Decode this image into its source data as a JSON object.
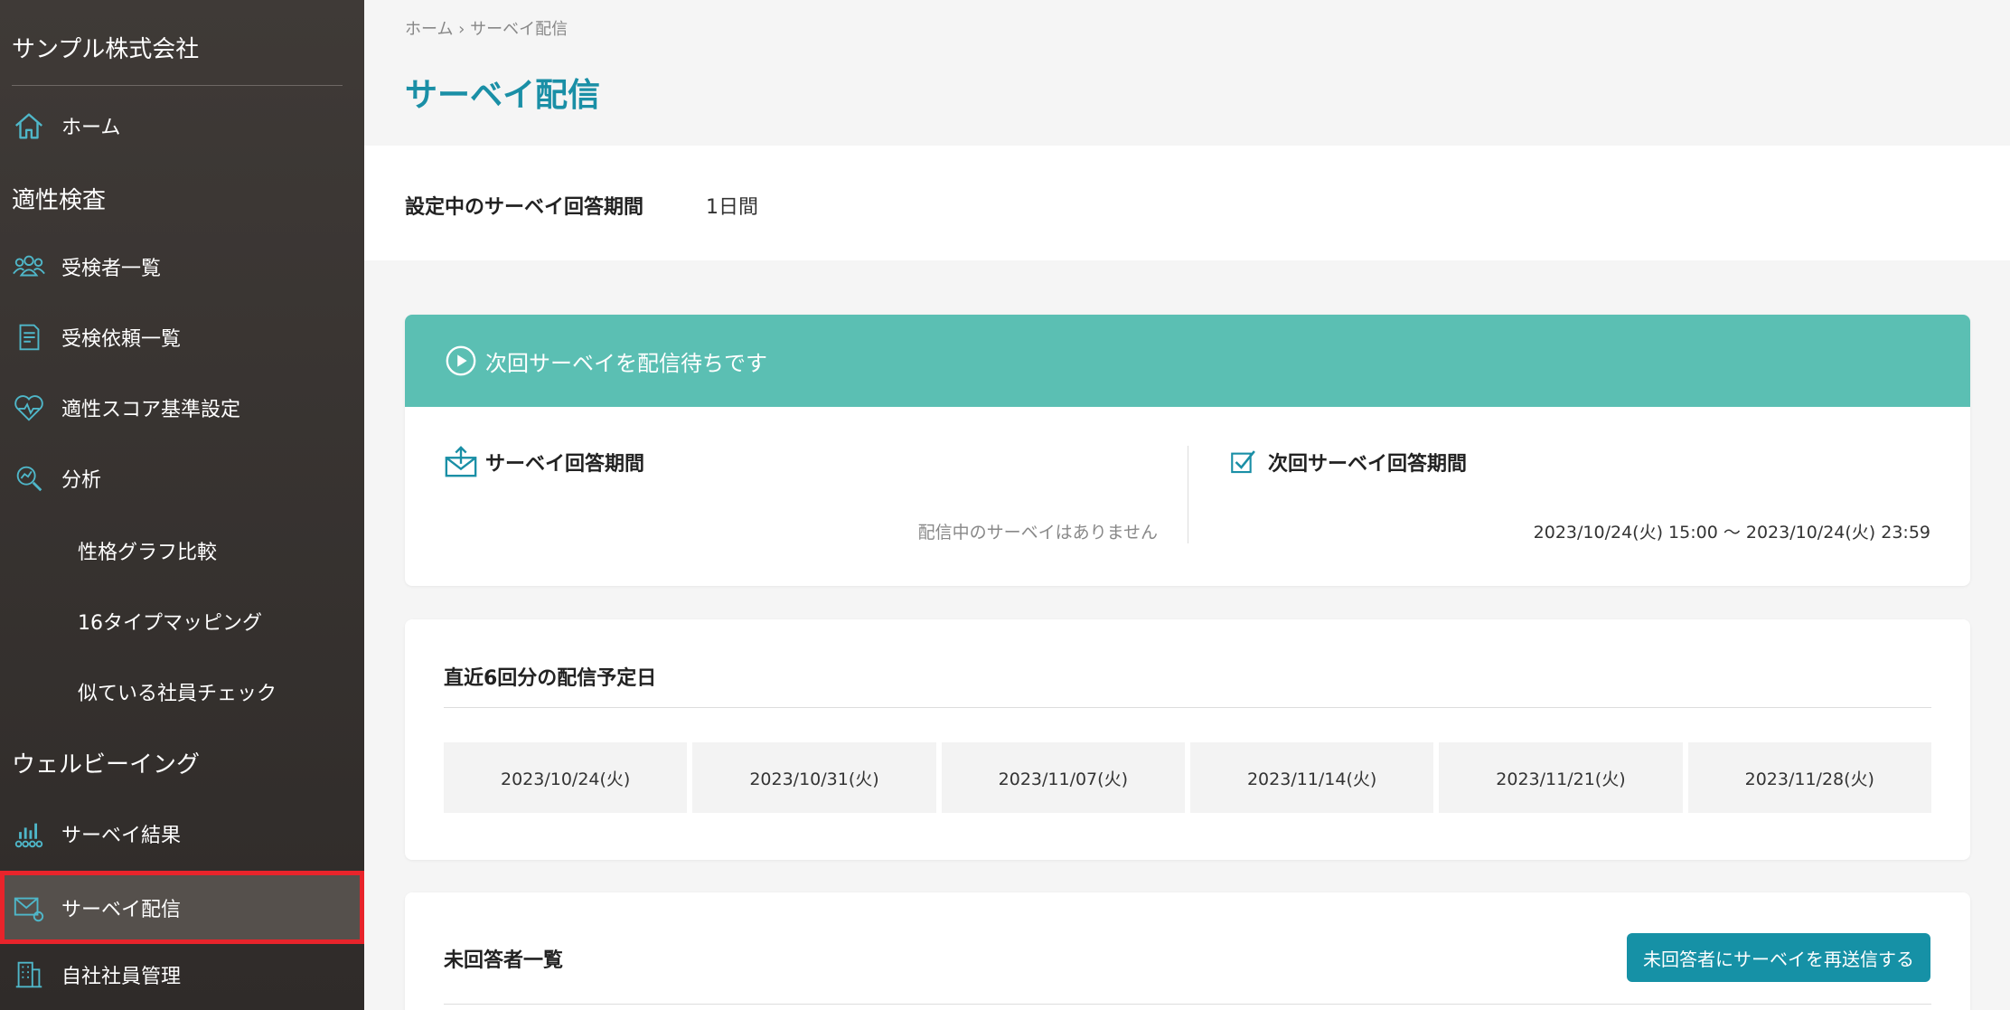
{
  "sidebar": {
    "company": "サンプル株式会社",
    "home": "ホーム",
    "section_aptitude": "適性検査",
    "examinees": "受検者一覧",
    "requests": "受検依頼一覧",
    "score_settings": "適性スコア基準設定",
    "analysis": "分析",
    "sub_personality": "性格グラフ比較",
    "sub_16type": "16タイプマッピング",
    "sub_similar": "似ている社員チェック",
    "section_wellbeing": "ウェルビーイング",
    "survey_results": "サーベイ結果",
    "survey_delivery": "サーベイ配信",
    "employee_mgmt": "自社社員管理"
  },
  "header": {
    "breadcrumb": "ホーム › サーベイ配信",
    "title": "サーベイ配信"
  },
  "period": {
    "label": "設定中のサーベイ回答期間",
    "value": "1日間"
  },
  "status": {
    "banner": "次回サーベイを配信待ちです",
    "current_title": "サーベイ回答期間",
    "current_value": "配信中のサーベイはありません",
    "next_title": "次回サーベイ回答期間",
    "next_value": "2023/10/24(火) 15:00 ～ 2023/10/24(火) 23:59"
  },
  "schedule": {
    "title": "直近6回分の配信予定日",
    "dates": [
      "2023/10/24(火)",
      "2023/10/31(火)",
      "2023/11/07(火)",
      "2023/11/14(火)",
      "2023/11/21(火)",
      "2023/11/28(火)"
    ]
  },
  "unanswered": {
    "title": "未回答者一覧",
    "resend_label": "未回答者にサーベイを再送信する"
  },
  "colors": {
    "accent": "#1a8fa6",
    "banner": "#5bbfb3",
    "highlight": "#e8242b"
  }
}
